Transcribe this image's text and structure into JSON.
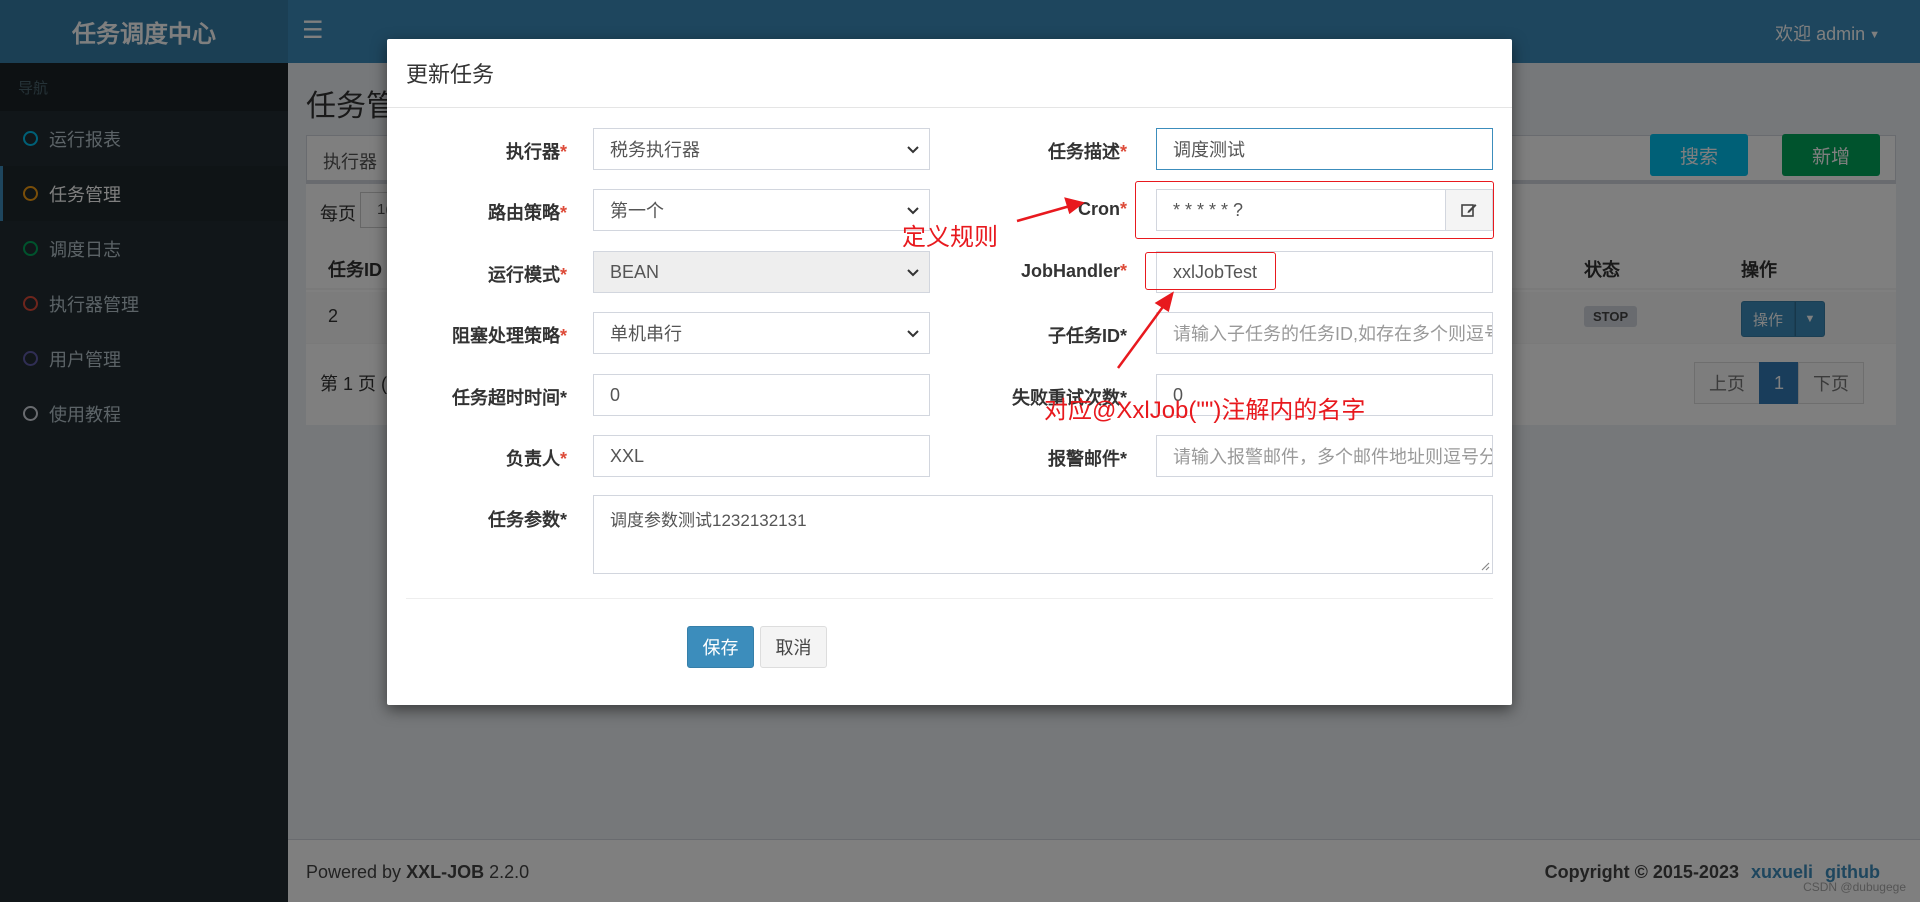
{
  "app": {
    "brand": "任务调度中心",
    "welcome": "欢迎 admin"
  },
  "sidebar": {
    "header": "导航",
    "items": [
      {
        "label": "运行报表",
        "color": "#00c0ef"
      },
      {
        "label": "任务管理",
        "color": "#f39c12"
      },
      {
        "label": "调度日志",
        "color": "#00a65a"
      },
      {
        "label": "执行器管理",
        "color": "#dd4b39"
      },
      {
        "label": "用户管理",
        "color": "#605ca8"
      },
      {
        "label": "使用教程",
        "color": "#d2d6de"
      }
    ]
  },
  "page": {
    "title": "任务管",
    "filter_executor_label": "执行器",
    "search_label": "搜索",
    "add_label": "新增",
    "per_page_label": "每页",
    "per_page_value": "1(",
    "columns": {
      "id": "任务ID",
      "status": "状态",
      "ops": "操作"
    },
    "row": {
      "id": "2",
      "status": "STOP",
      "op_label": "操作"
    },
    "page_info": "第 1 页 (",
    "pager": {
      "prev": "上页",
      "current": "1",
      "next": "下页"
    }
  },
  "footer": {
    "powered_prefix": "Powered by ",
    "powered_name": "XXL-JOB",
    "version": "2.2.0",
    "copyright": "Copyright © 2015-2023",
    "link1": "xuxueli",
    "link2": "github",
    "watermark": "CSDN @dubugege"
  },
  "modal": {
    "title": "更新任务",
    "fields": {
      "executor": {
        "label": "执行器",
        "required": "*",
        "value": "税务执行器"
      },
      "desc": {
        "label": "任务描述",
        "required": "*",
        "value": "调度测试"
      },
      "route": {
        "label": "路由策略",
        "required": "*",
        "value": "第一个"
      },
      "cron": {
        "label": "Cron",
        "required": "*",
        "value": "* * * * * ?"
      },
      "run_mode": {
        "label": "运行模式",
        "required": "*",
        "value": "BEAN"
      },
      "job_handler": {
        "label": "JobHandler",
        "required": "*",
        "value": "xxlJobTest"
      },
      "block": {
        "label": "阻塞处理策略",
        "required": "*",
        "value": "单机串行"
      },
      "child_id": {
        "label": "子任务ID*",
        "placeholder": "请输入子任务的任务ID,如存在多个则逗号分隔"
      },
      "timeout": {
        "label": "任务超时时间*",
        "value": "0"
      },
      "retry": {
        "label": "失败重试次数*",
        "value": "0"
      },
      "author": {
        "label": "负责人",
        "required": "*",
        "value": "XXL"
      },
      "alarm": {
        "label": "报警邮件*",
        "placeholder": "请输入报警邮件，多个邮件地址则逗号分隔"
      },
      "param": {
        "label": "任务参数*",
        "value": "调度参数测试1232132131"
      }
    },
    "save_label": "保存",
    "cancel_label": "取消"
  },
  "annotations": {
    "rule": "定义规则",
    "handler_note": "对应@XxlJob(\"\")注解内的名字",
    "color": "#e8191e"
  }
}
